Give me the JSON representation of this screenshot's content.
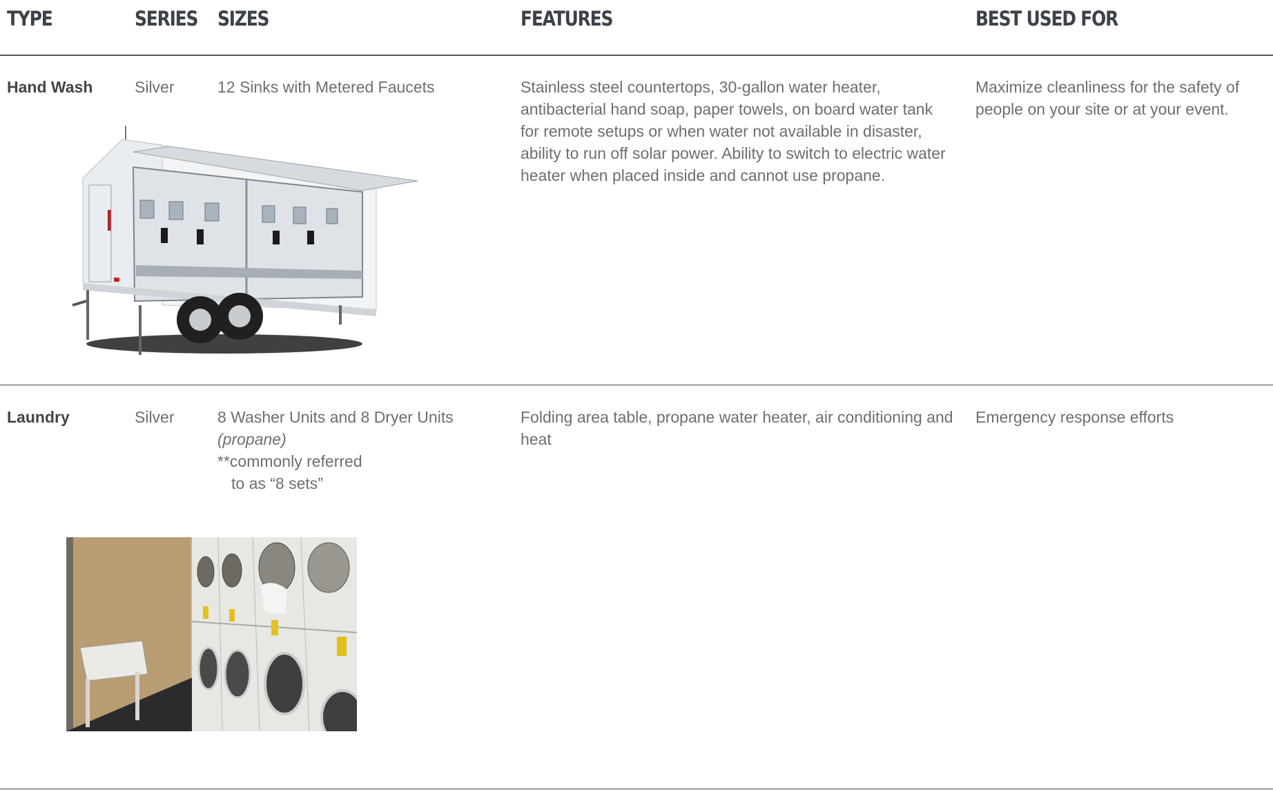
{
  "columns": {
    "type": "TYPE",
    "series": "SERIES",
    "sizes": "SIZES",
    "features": "FEATURES",
    "best": "BEST USED FOR"
  },
  "rows": [
    {
      "type": "Hand Wash",
      "series": "Silver",
      "sizes": [
        "12 Sinks with Metered Faucets"
      ],
      "features": "Stainless steel countertops, 30-gallon water heater, antibacterial hand soap, paper towels, on board water tank for remote setups or when water not available in disaster, ability to run off solar power. Ability to switch to electric water heater when placed inside and cannot use propane.",
      "best": "Maximize cleanliness for the safety of people on your site or at your event."
    },
    {
      "type": "Laundry",
      "series": "Silver",
      "sizes": [
        "8 Washer Units and 8 Dryer Units",
        "(propane)",
        "**commonly referred",
        "to as “8 sets”"
      ],
      "features": "Folding area table, propane water heater, air conditioning and heat",
      "best": "Emergency response efforts"
    }
  ]
}
